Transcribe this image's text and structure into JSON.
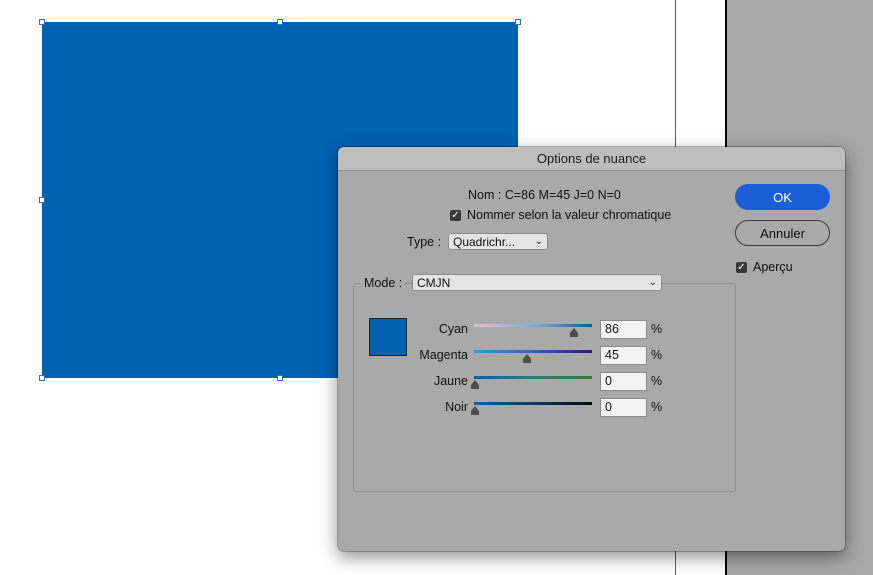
{
  "canvas": {
    "rect_color": "#0062b1"
  },
  "dialog": {
    "title": "Options de nuance",
    "name_label": "Nom :",
    "name_value": "C=86 M=45 J=0 N=0",
    "name_by_value_label": "Nommer selon la valeur chromatique",
    "name_by_value_checked": true,
    "type_label": "Type :",
    "type_value": "Quadrichr...",
    "ok_label": "OK",
    "cancel_label": "Annuler",
    "preview_label": "Aperçu",
    "preview_checked": true,
    "mode_label": "Mode :",
    "mode_value": "CMJN",
    "swatch_color": "#0062b1",
    "sliders": [
      {
        "label": "Cyan",
        "value": "86",
        "unit": "%"
      },
      {
        "label": "Magenta",
        "value": "45",
        "unit": "%"
      },
      {
        "label": "Jaune",
        "value": "0",
        "unit": "%"
      },
      {
        "label": "Noir",
        "value": "0",
        "unit": "%"
      }
    ]
  }
}
